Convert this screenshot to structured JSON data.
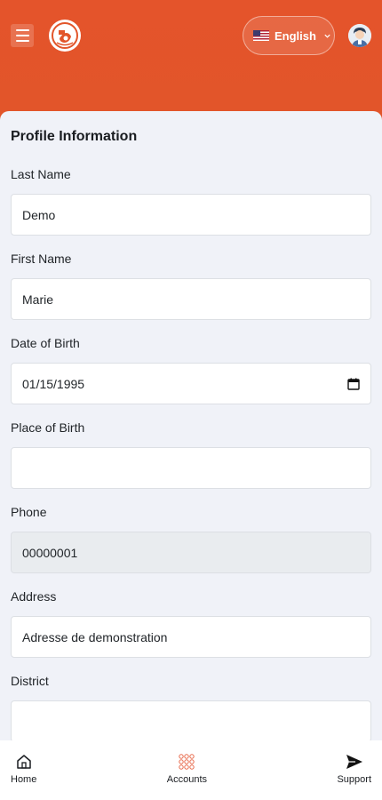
{
  "header": {
    "menu_icon": "hamburger-icon",
    "logo_icon": "brand-logo",
    "language": {
      "label": "English",
      "flag_icon": "us-flag-icon"
    },
    "avatar_icon": "user-avatar-icon"
  },
  "colors": {
    "brand": "#e2552a",
    "card_bg": "#f0f2f8",
    "accent_icon": "#e86a4c"
  },
  "profile": {
    "title": "Profile Information",
    "fields": [
      {
        "label": "Last Name",
        "value": "Demo"
      },
      {
        "label": "First Name",
        "value": "Marie"
      },
      {
        "label": "Date of Birth",
        "value": "01/15/1995"
      },
      {
        "label": "Place of Birth",
        "value": ""
      },
      {
        "label": "Phone",
        "value": "00000001"
      },
      {
        "label": "Address",
        "value": "Adresse de demonstration"
      },
      {
        "label": "District",
        "value": ""
      }
    ]
  },
  "nav": {
    "home": "Home",
    "accounts": "Accounts",
    "support": "Support"
  }
}
